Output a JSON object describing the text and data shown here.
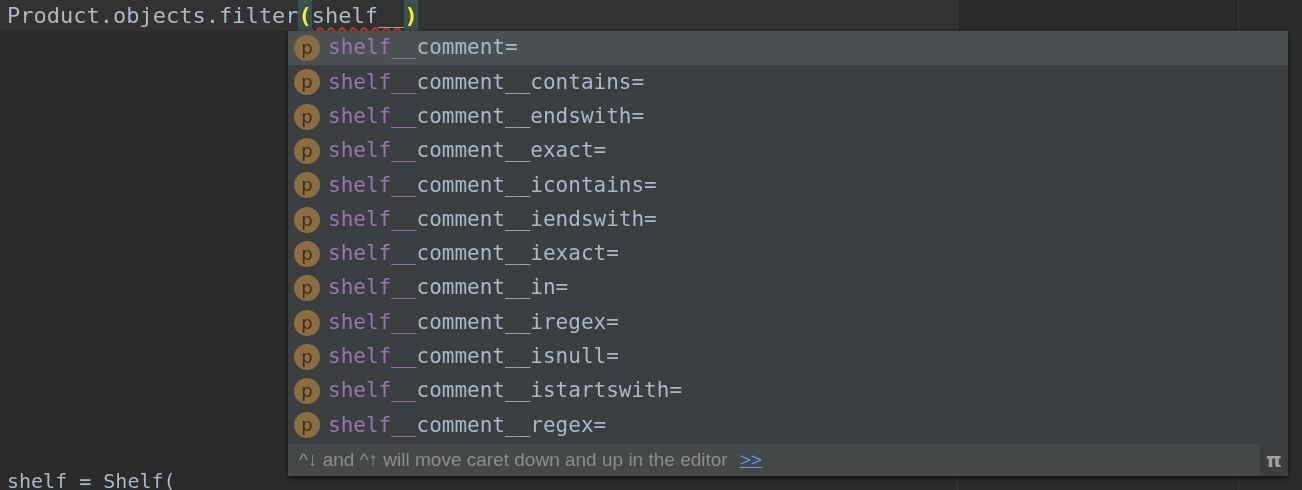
{
  "editor": {
    "code_line": {
      "prefix": "Product.objects.filter",
      "open_paren": "(",
      "argument": "shelf__",
      "close_paren": ")",
      "argument_error": true
    },
    "bottom_line": "shelf = Shelf("
  },
  "completion": {
    "items": [
      {
        "icon": "p",
        "match": "shelf__",
        "rest": "comment=",
        "selected": true
      },
      {
        "icon": "p",
        "match": "shelf__",
        "rest": "comment__contains=",
        "selected": false
      },
      {
        "icon": "p",
        "match": "shelf__",
        "rest": "comment__endswith=",
        "selected": false
      },
      {
        "icon": "p",
        "match": "shelf__",
        "rest": "comment__exact=",
        "selected": false
      },
      {
        "icon": "p",
        "match": "shelf__",
        "rest": "comment__icontains=",
        "selected": false
      },
      {
        "icon": "p",
        "match": "shelf__",
        "rest": "comment__iendswith=",
        "selected": false
      },
      {
        "icon": "p",
        "match": "shelf__",
        "rest": "comment__iexact=",
        "selected": false
      },
      {
        "icon": "p",
        "match": "shelf__",
        "rest": "comment__in=",
        "selected": false
      },
      {
        "icon": "p",
        "match": "shelf__",
        "rest": "comment__iregex=",
        "selected": false
      },
      {
        "icon": "p",
        "match": "shelf__",
        "rest": "comment__isnull=",
        "selected": false
      },
      {
        "icon": "p",
        "match": "shelf__",
        "rest": "comment__istartswith=",
        "selected": false
      },
      {
        "icon": "p",
        "match": "shelf__",
        "rest": "comment__regex=",
        "selected": false
      }
    ],
    "footer": {
      "hint": "^↓ and ^↑ will move caret down and up in the editor",
      "link": ">>",
      "pi": "π"
    }
  }
}
